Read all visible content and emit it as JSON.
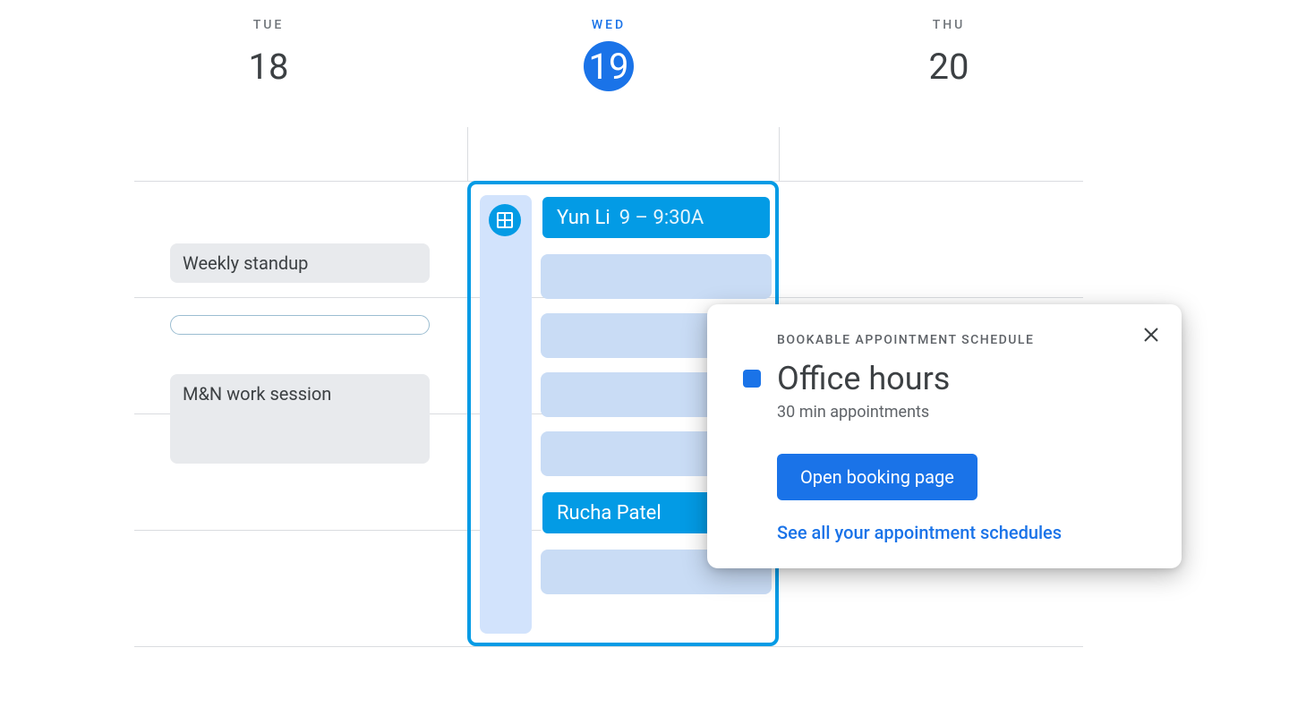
{
  "days": [
    {
      "name": "TUE",
      "number": "18",
      "active": false
    },
    {
      "name": "WED",
      "number": "19",
      "active": true
    },
    {
      "name": "THU",
      "number": "20",
      "active": false
    }
  ],
  "tue_events": {
    "standup": "Weekly standup",
    "session": "M&N work session"
  },
  "wed_slots": {
    "booked1_name": "Yun Li",
    "booked1_time": "9 – 9:30A",
    "booked2_name": "Rucha Patel"
  },
  "popover": {
    "label": "BOOKABLE APPOINTMENT SCHEDULE",
    "title": "Office hours",
    "subtitle": "30 min appointments",
    "button": "Open booking page",
    "link": "See all your appointment schedules"
  }
}
